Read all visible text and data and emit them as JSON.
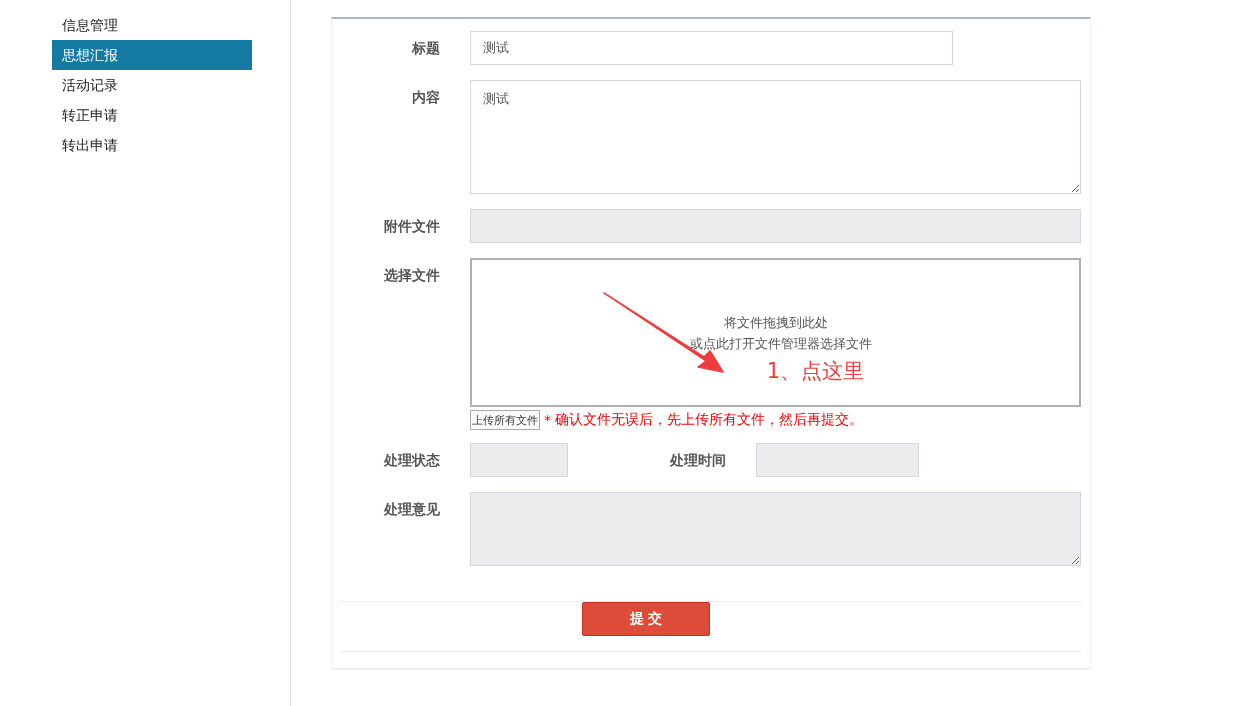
{
  "sidebar": {
    "items": [
      {
        "label": "信息管理",
        "selected": false
      },
      {
        "label": "思想汇报",
        "selected": true
      },
      {
        "label": "活动记录",
        "selected": false
      },
      {
        "label": "转正申请",
        "selected": false
      },
      {
        "label": "转出申请",
        "selected": false
      }
    ]
  },
  "form": {
    "title": {
      "label": "标题",
      "value": "测试"
    },
    "content": {
      "label": "内容",
      "value": "测试"
    },
    "attachment": {
      "label": "附件文件",
      "disabled": true
    },
    "file_select": {
      "label": "选择文件",
      "drop_hint": "将文件拖拽到此处",
      "browse_hint": "或点此打开文件管理器选择文件",
      "annotation": "1、点这里",
      "upload_button": "上传所有文件",
      "required_mark": "*",
      "notice": "确认文件无误后，先上传所有文件，然后再提交。"
    },
    "status": {
      "label": "处理状态",
      "disabled": true
    },
    "time": {
      "label": "处理时间",
      "disabled": true
    },
    "opinion": {
      "label": "处理意见",
      "disabled": true
    },
    "submit": "提 交"
  }
}
